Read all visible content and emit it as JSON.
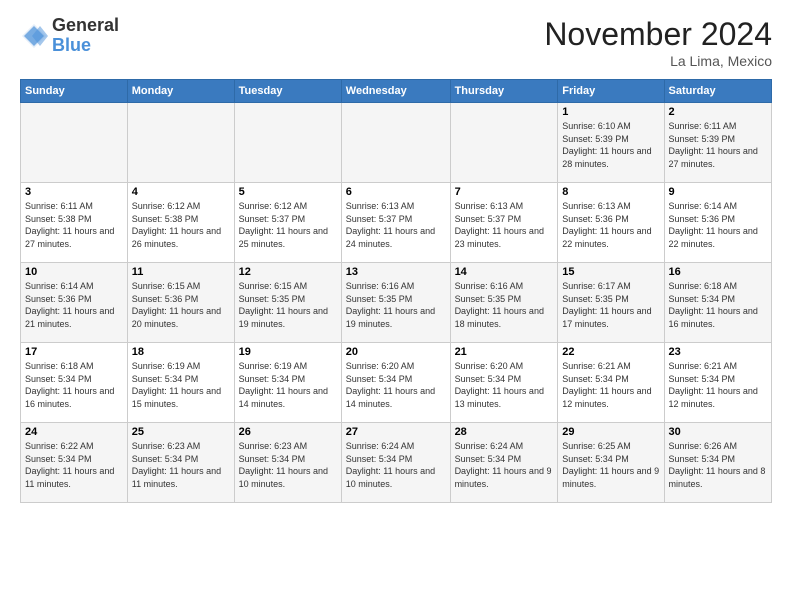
{
  "header": {
    "logo_general": "General",
    "logo_blue": "Blue",
    "month_title": "November 2024",
    "location": "La Lima, Mexico"
  },
  "weekdays": [
    "Sunday",
    "Monday",
    "Tuesday",
    "Wednesday",
    "Thursday",
    "Friday",
    "Saturday"
  ],
  "weeks": [
    [
      {
        "day": "",
        "info": ""
      },
      {
        "day": "",
        "info": ""
      },
      {
        "day": "",
        "info": ""
      },
      {
        "day": "",
        "info": ""
      },
      {
        "day": "",
        "info": ""
      },
      {
        "day": "1",
        "info": "Sunrise: 6:10 AM\nSunset: 5:39 PM\nDaylight: 11 hours and 28 minutes."
      },
      {
        "day": "2",
        "info": "Sunrise: 6:11 AM\nSunset: 5:39 PM\nDaylight: 11 hours and 27 minutes."
      }
    ],
    [
      {
        "day": "3",
        "info": "Sunrise: 6:11 AM\nSunset: 5:38 PM\nDaylight: 11 hours and 27 minutes."
      },
      {
        "day": "4",
        "info": "Sunrise: 6:12 AM\nSunset: 5:38 PM\nDaylight: 11 hours and 26 minutes."
      },
      {
        "day": "5",
        "info": "Sunrise: 6:12 AM\nSunset: 5:37 PM\nDaylight: 11 hours and 25 minutes."
      },
      {
        "day": "6",
        "info": "Sunrise: 6:13 AM\nSunset: 5:37 PM\nDaylight: 11 hours and 24 minutes."
      },
      {
        "day": "7",
        "info": "Sunrise: 6:13 AM\nSunset: 5:37 PM\nDaylight: 11 hours and 23 minutes."
      },
      {
        "day": "8",
        "info": "Sunrise: 6:13 AM\nSunset: 5:36 PM\nDaylight: 11 hours and 22 minutes."
      },
      {
        "day": "9",
        "info": "Sunrise: 6:14 AM\nSunset: 5:36 PM\nDaylight: 11 hours and 22 minutes."
      }
    ],
    [
      {
        "day": "10",
        "info": "Sunrise: 6:14 AM\nSunset: 5:36 PM\nDaylight: 11 hours and 21 minutes."
      },
      {
        "day": "11",
        "info": "Sunrise: 6:15 AM\nSunset: 5:36 PM\nDaylight: 11 hours and 20 minutes."
      },
      {
        "day": "12",
        "info": "Sunrise: 6:15 AM\nSunset: 5:35 PM\nDaylight: 11 hours and 19 minutes."
      },
      {
        "day": "13",
        "info": "Sunrise: 6:16 AM\nSunset: 5:35 PM\nDaylight: 11 hours and 19 minutes."
      },
      {
        "day": "14",
        "info": "Sunrise: 6:16 AM\nSunset: 5:35 PM\nDaylight: 11 hours and 18 minutes."
      },
      {
        "day": "15",
        "info": "Sunrise: 6:17 AM\nSunset: 5:35 PM\nDaylight: 11 hours and 17 minutes."
      },
      {
        "day": "16",
        "info": "Sunrise: 6:18 AM\nSunset: 5:34 PM\nDaylight: 11 hours and 16 minutes."
      }
    ],
    [
      {
        "day": "17",
        "info": "Sunrise: 6:18 AM\nSunset: 5:34 PM\nDaylight: 11 hours and 16 minutes."
      },
      {
        "day": "18",
        "info": "Sunrise: 6:19 AM\nSunset: 5:34 PM\nDaylight: 11 hours and 15 minutes."
      },
      {
        "day": "19",
        "info": "Sunrise: 6:19 AM\nSunset: 5:34 PM\nDaylight: 11 hours and 14 minutes."
      },
      {
        "day": "20",
        "info": "Sunrise: 6:20 AM\nSunset: 5:34 PM\nDaylight: 11 hours and 14 minutes."
      },
      {
        "day": "21",
        "info": "Sunrise: 6:20 AM\nSunset: 5:34 PM\nDaylight: 11 hours and 13 minutes."
      },
      {
        "day": "22",
        "info": "Sunrise: 6:21 AM\nSunset: 5:34 PM\nDaylight: 11 hours and 12 minutes."
      },
      {
        "day": "23",
        "info": "Sunrise: 6:21 AM\nSunset: 5:34 PM\nDaylight: 11 hours and 12 minutes."
      }
    ],
    [
      {
        "day": "24",
        "info": "Sunrise: 6:22 AM\nSunset: 5:34 PM\nDaylight: 11 hours and 11 minutes."
      },
      {
        "day": "25",
        "info": "Sunrise: 6:23 AM\nSunset: 5:34 PM\nDaylight: 11 hours and 11 minutes."
      },
      {
        "day": "26",
        "info": "Sunrise: 6:23 AM\nSunset: 5:34 PM\nDaylight: 11 hours and 10 minutes."
      },
      {
        "day": "27",
        "info": "Sunrise: 6:24 AM\nSunset: 5:34 PM\nDaylight: 11 hours and 10 minutes."
      },
      {
        "day": "28",
        "info": "Sunrise: 6:24 AM\nSunset: 5:34 PM\nDaylight: 11 hours and 9 minutes."
      },
      {
        "day": "29",
        "info": "Sunrise: 6:25 AM\nSunset: 5:34 PM\nDaylight: 11 hours and 9 minutes."
      },
      {
        "day": "30",
        "info": "Sunrise: 6:26 AM\nSunset: 5:34 PM\nDaylight: 11 hours and 8 minutes."
      }
    ]
  ]
}
